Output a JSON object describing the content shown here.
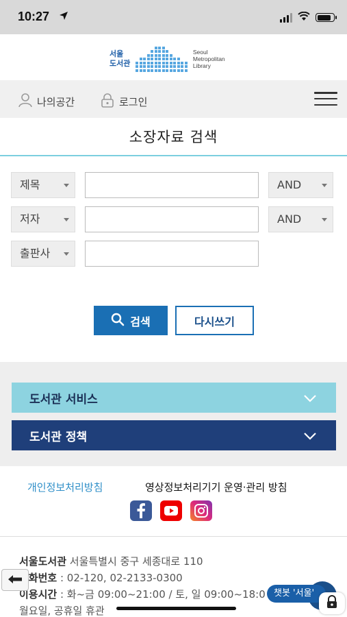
{
  "status_bar": {
    "time": "10:27"
  },
  "logo": {
    "ko_line1": "서울",
    "ko_line2": "도서관",
    "en_line1": "Seoul",
    "en_line2": "Metropolitan",
    "en_line3": "Library",
    "color": "#57a7e0"
  },
  "user_bar": {
    "my_space": "나의공간",
    "login": "로그인"
  },
  "page_title": "소장자료 검색",
  "search_form": {
    "rows": [
      {
        "field": "제목",
        "value": "",
        "operator": "AND"
      },
      {
        "field": "저자",
        "value": "",
        "operator": "AND"
      },
      {
        "field": "출판사",
        "value": ""
      }
    ],
    "search_label": "검색",
    "reset_label": "다시쓰기"
  },
  "accordions": [
    {
      "label": "도서관 서비스",
      "color": "#8dd3e0"
    },
    {
      "label": "도서관 정책",
      "color": "#1f3f7a"
    }
  ],
  "policy_links": {
    "privacy": "개인정보처리방침",
    "cctv": "영상정보처리기기 운영·관리 방침"
  },
  "social": [
    "facebook-icon",
    "youtube-icon",
    "instagram-icon"
  ],
  "footer": {
    "name": "서울도서관",
    "address": "서울특별시 중구 세종대로 110",
    "phone_label": "전화번호",
    "phone": "02-120, 02-2133-0300",
    "hours_label": "이용시간",
    "hours": "화~금 09:00~21:00 / 토, 일 09:00~18:00",
    "closed": "월요일, 공휴일 휴관"
  },
  "chatbot_label": "챗봇 '서울'"
}
